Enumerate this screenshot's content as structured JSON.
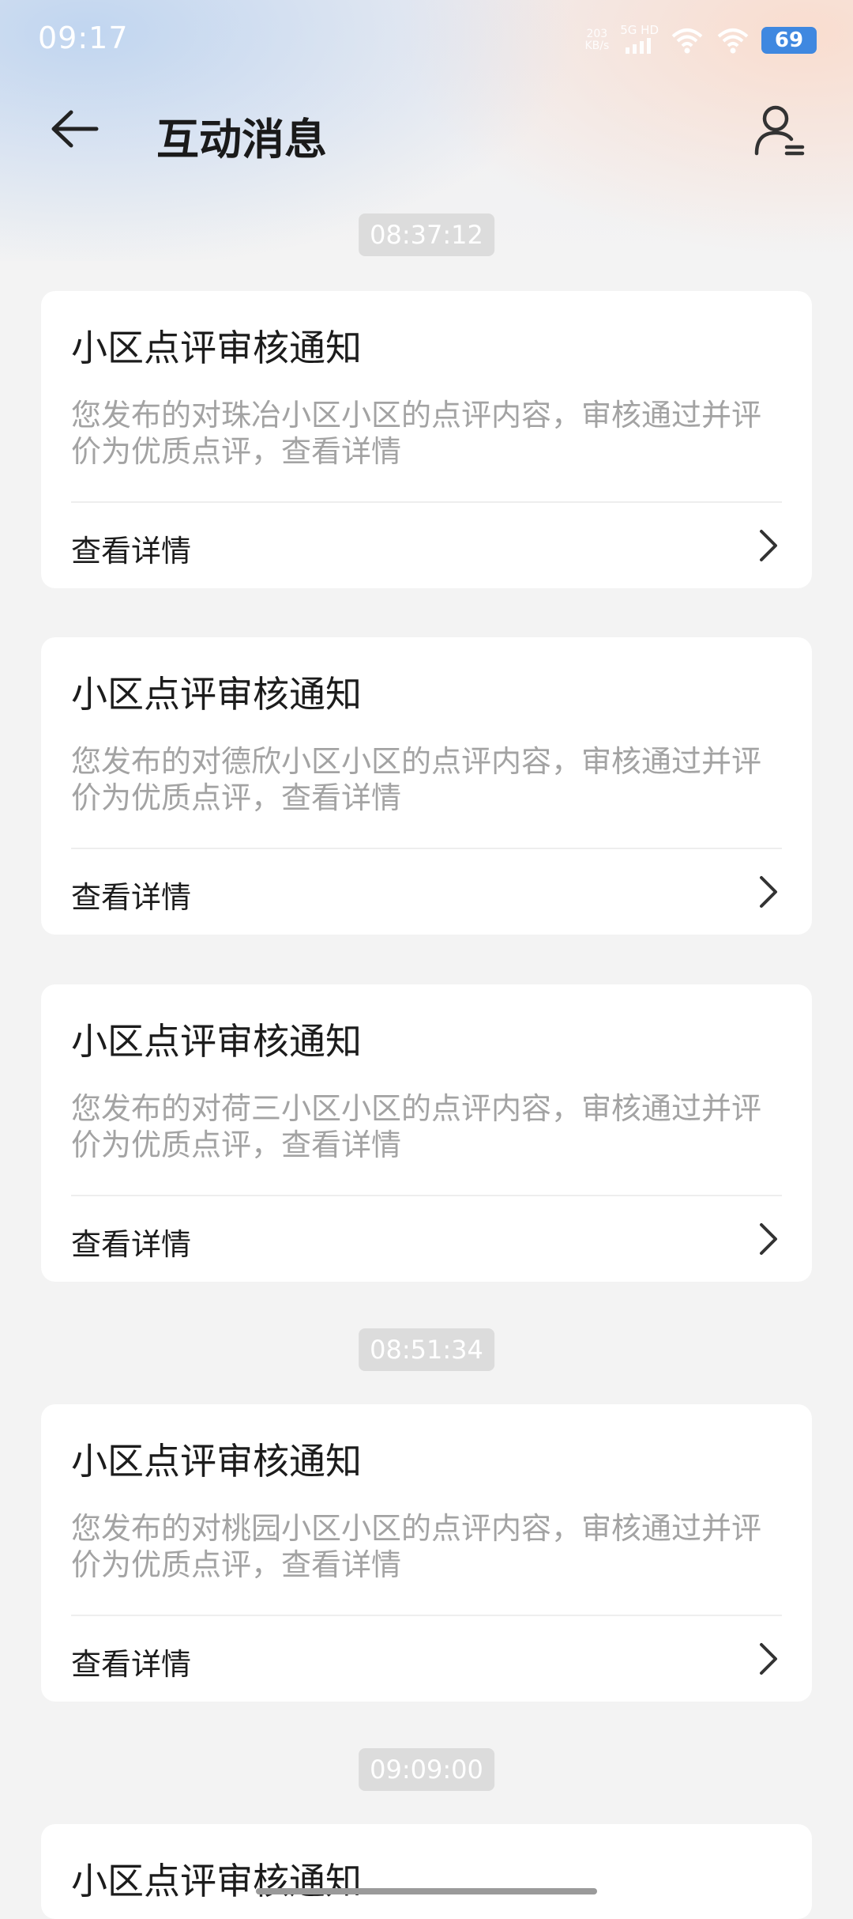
{
  "status_bar": {
    "time": "09:17",
    "net_speed_value": "203",
    "net_speed_unit": "KB/s",
    "network_type": "5G HD",
    "battery": "69"
  },
  "header": {
    "title": "互动消息"
  },
  "timestamps": [
    "08:37:12",
    "08:51:34",
    "09:09:00"
  ],
  "messages": [
    {
      "title": "小区点评审核通知",
      "desc": "您发布的对珠冶小区小区的点评内容，审核通过并评价为优质点评，查看详情",
      "action": "查看详情"
    },
    {
      "title": "小区点评审核通知",
      "desc": "您发布的对德欣小区小区的点评内容，审核通过并评价为优质点评，查看详情",
      "action": "查看详情"
    },
    {
      "title": "小区点评审核通知",
      "desc": "您发布的对荷三小区小区的点评内容，审核通过并评价为优质点评，查看详情",
      "action": "查看详情"
    },
    {
      "title": "小区点评审核通知",
      "desc": "您发布的对桃园小区小区的点评内容，审核通过并评价为优质点评，查看详情",
      "action": "查看详情"
    },
    {
      "title": "小区点评审核通知"
    }
  ],
  "icons": {
    "back": "back-arrow-icon",
    "profile": "person-list-icon",
    "chevron": "chevron-right-icon",
    "signal": "signal-bars-icon",
    "wifi": "wifi-icon"
  },
  "colors": {
    "battery_fill": "#3f88e0",
    "timestamp_pill": "#dcdcdc",
    "desc_text": "#a3a3a3"
  }
}
